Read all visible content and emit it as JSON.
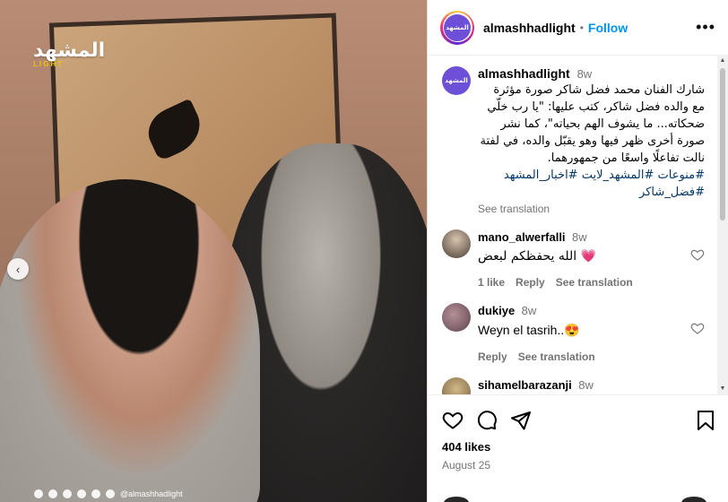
{
  "photo": {
    "watermark_logo": "المشهد",
    "watermark_sub": "LIGHT",
    "footer_handle": "@almashhadlight"
  },
  "header": {
    "avatar_text": "المشهد",
    "username": "almashhadlight",
    "separator": "•",
    "follow_label": "Follow",
    "more_label": "•••"
  },
  "caption": {
    "username": "almashhadlight",
    "time": "8w",
    "text": "شارك الفنان محمد فضل شاكر صورة مؤثرة مع والده فضل شاكر، كتب عليها: \"يا رب خلّي ضحكاته... ما يشوف الهم بحياته\"، كما نشر صورة أخرى ظهر فيها وهو يقبّل والده، في لفتة نالت تفاعلًا واسعًا من جمهورهما.",
    "tags": "#منوعات #المشهد_لايت #اخبار_المشهد #فضل_شاكر",
    "see_translation": "See translation"
  },
  "comments": [
    {
      "user": "mano_alwerfalli",
      "time": "8w",
      "text": "الله يحفظكم لبعض 💗",
      "likes": "1 like",
      "reply": "Reply",
      "see_translation": "See translation",
      "avatar_color": "#8a7a6a"
    },
    {
      "user": "dukiye",
      "time": "8w",
      "text": "Weyn el tasrih..😍",
      "reply": "Reply",
      "see_translation": "See translation",
      "avatar_color": "#8a6a72"
    },
    {
      "user": "sihamelbarazanji",
      "time": "8w",
      "avatar_color": "#a08860"
    }
  ],
  "actions": {
    "likes": "404 likes",
    "date": "August 25"
  },
  "colors": {
    "link": "#0095f6",
    "hashtag": "#00376b",
    "muted": "#737373"
  }
}
